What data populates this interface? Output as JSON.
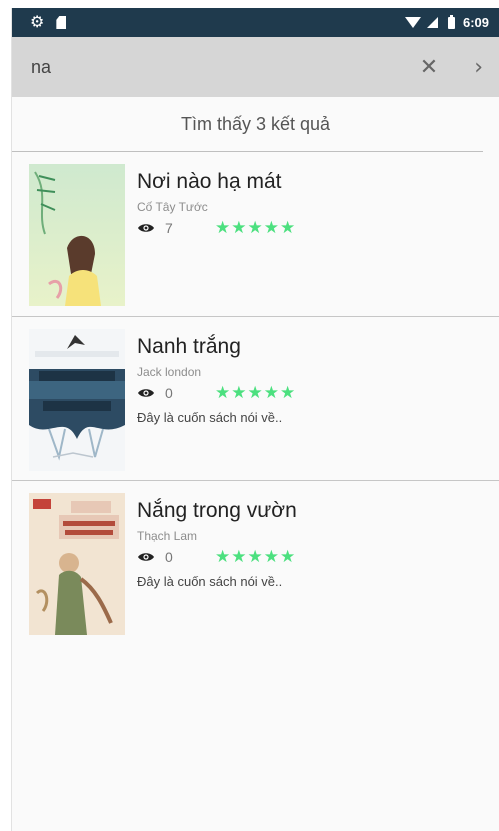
{
  "status_bar": {
    "time": "6:09",
    "icons": [
      "gear-icon",
      "sd-card-icon",
      "wifi-icon",
      "signal-icon",
      "battery-icon"
    ]
  },
  "search": {
    "query": "na",
    "clear_icon": "close-icon",
    "go_icon": "chevron-right-icon"
  },
  "results": {
    "summary": "Tìm thấy 3 kết quả",
    "books": [
      {
        "title": "Nơi nào hạ mát",
        "author": "Cố Tây Tước",
        "views": "7",
        "rating_stars": "★★★★★",
        "rating": 5,
        "description": "",
        "cover_colors": [
          "#cfe9cf",
          "#e8f2c9"
        ]
      },
      {
        "title": "Nanh trắng",
        "author": "Jack london",
        "views": "0",
        "rating_stars": "★★★★★",
        "rating": 5,
        "description": "Đây là cuốn sách nói về..",
        "cover_colors": [
          "#f4f6f8",
          "#2d4b63"
        ]
      },
      {
        "title": "Nắng trong vườn",
        "author": "Thạch Lam",
        "views": "0",
        "rating_stars": "★★★★★",
        "rating": 5,
        "description": "Đây là cuốn sách nói về..",
        "cover_colors": [
          "#f2e4d2",
          "#b34b3b"
        ]
      }
    ]
  },
  "colors": {
    "status_bar": "#1f3a4d",
    "search_bar": "#d6d6d6",
    "star": "#4ce07f"
  }
}
